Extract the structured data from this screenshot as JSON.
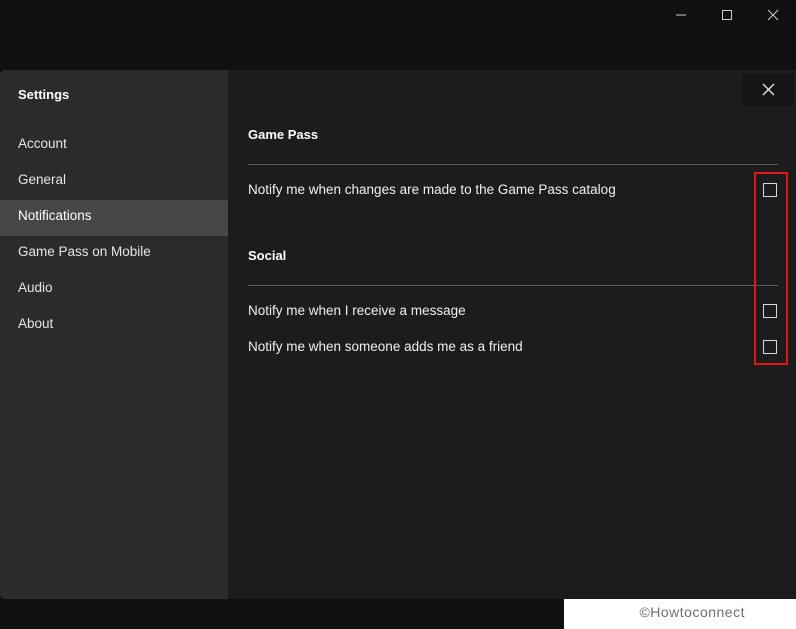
{
  "window_controls": {
    "minimize_icon": "minimize-icon",
    "maximize_icon": "maximize-icon",
    "close_icon": "close-icon"
  },
  "sidebar": {
    "title": "Settings",
    "items": [
      {
        "label": "Account",
        "active": false
      },
      {
        "label": "General",
        "active": false
      },
      {
        "label": "Notifications",
        "active": true
      },
      {
        "label": "Game Pass on Mobile",
        "active": false
      },
      {
        "label": "Audio",
        "active": false
      },
      {
        "label": "About",
        "active": false
      }
    ]
  },
  "main": {
    "sections": [
      {
        "heading": "Game Pass",
        "options": [
          {
            "label": "Notify me when changes are made to the Game Pass catalog",
            "checked": false
          }
        ]
      },
      {
        "heading": "Social",
        "options": [
          {
            "label": "Notify me when I receive a message",
            "checked": false
          },
          {
            "label": "Notify me when someone adds me as a friend",
            "checked": false
          }
        ]
      }
    ]
  },
  "watermark": "©Howtoconnect",
  "colors": {
    "highlight": "#e01818",
    "sidebar_bg": "#2b2b2b",
    "active_item_bg": "#474747",
    "main_bg": "#1c1c1c"
  }
}
